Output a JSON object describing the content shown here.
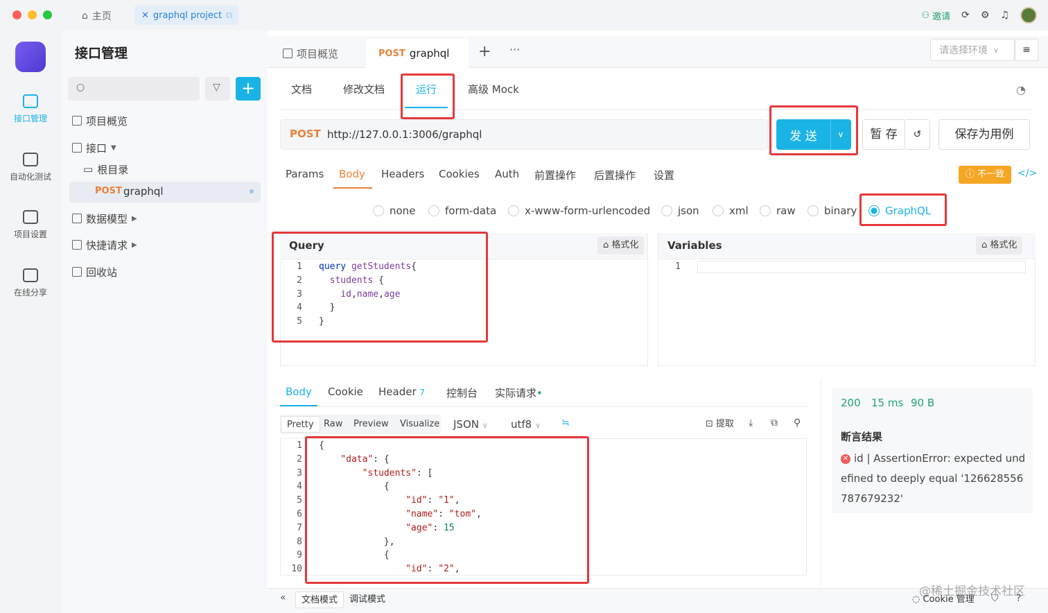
{
  "titlebar": {
    "home": "主页",
    "project_tab": "graphql project",
    "invite": "邀请"
  },
  "rail": {
    "items": [
      "接口管理",
      "自动化测试",
      "项目设置",
      "在线分享"
    ]
  },
  "tree": {
    "title": "接口管理",
    "items": [
      "项目概览",
      "接口",
      "根目录",
      "数据模型",
      "快捷请求",
      "回收站"
    ],
    "active_method": "POST",
    "active_name": "graphql"
  },
  "doc_tabs": {
    "overview": "项目概览",
    "method": "POST",
    "name": "graphql",
    "env_placeholder": "请选择环境"
  },
  "subtabs": {
    "doc": "文档",
    "edit": "修改文档",
    "run": "运行",
    "mock": "高级 Mock"
  },
  "request": {
    "method": "POST",
    "url": "http://127.0.0.1:3006/graphql",
    "send": "发 送",
    "save_draft": "暂 存",
    "save_case": "保存为用例"
  },
  "req_tabs": [
    "Params",
    "Body",
    "Headers",
    "Cookies",
    "Auth",
    "前置操作",
    "后置操作",
    "设置"
  ],
  "mismatch": "不一致",
  "body_types": [
    "none",
    "form-data",
    "x-www-form-urlencoded",
    "json",
    "xml",
    "raw",
    "binary",
    "GraphQL"
  ],
  "query": {
    "title": "Query",
    "format": "格式化",
    "lines": [
      {
        "n": "1",
        "html": "<span class='kw'>query</span> <span class='fn'>getStudents</span>{"
      },
      {
        "n": "2",
        "html": "  <span class='fn'>students</span> {"
      },
      {
        "n": "3",
        "html": "    <span class='fn'>id</span>,<span class='fn'>name</span>,<span class='fn'>age</span>"
      },
      {
        "n": "4",
        "html": "  }"
      },
      {
        "n": "5",
        "html": "}"
      }
    ]
  },
  "variables": {
    "title": "Variables",
    "format": "格式化",
    "line": "1"
  },
  "response": {
    "tabs": [
      "Body",
      "Cookie",
      "Header",
      "控制台",
      "实际请求"
    ],
    "header_count": "7",
    "views": [
      "Pretty",
      "Raw",
      "Preview",
      "Visualize"
    ],
    "format": "JSON",
    "encoding": "utf8",
    "extract": "提取",
    "lines": [
      {
        "n": "1",
        "html": "{"
      },
      {
        "n": "2",
        "html": "    <span class='str'>\"data\"</span>: {"
      },
      {
        "n": "3",
        "html": "        <span class='str'>\"students\"</span>: ["
      },
      {
        "n": "4",
        "html": "            {"
      },
      {
        "n": "5",
        "html": "                <span class='str'>\"id\"</span>: <span class='str'>\"1\"</span>,"
      },
      {
        "n": "6",
        "html": "                <span class='str'>\"name\"</span>: <span class='str'>\"tom\"</span>,"
      },
      {
        "n": "7",
        "html": "                <span class='str'>\"age\"</span>: <span class='num'>15</span>"
      },
      {
        "n": "8",
        "html": "            },"
      },
      {
        "n": "9",
        "html": "            {"
      },
      {
        "n": "10",
        "html": "                <span class='str'>\"id\"</span>: <span class='str'>\"2\"</span>,"
      }
    ]
  },
  "result": {
    "status": "200",
    "time": "15 ms",
    "size": "90 B",
    "assert_title": "断言结果",
    "assert_msg": "id | AssertionError: expected undefined to deeply equal '126628556787679232'"
  },
  "bottom": {
    "doc_mode": "文档模式",
    "debug_mode": "调试模式",
    "cookie": "Cookie 管理",
    "watermark": "@稀土掘金技术社区"
  },
  "colors": {
    "accent": "#1ab3e6",
    "post": "#e8823a",
    "success": "#22a372",
    "highlight": "#e5383b"
  }
}
